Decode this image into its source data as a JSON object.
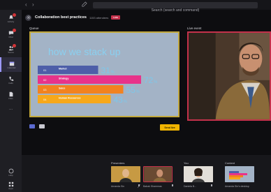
{
  "top_bar": {
    "search_placeholder": "Search (search and command)"
  },
  "sidebar": {
    "items": [
      {
        "label": "Activity",
        "icon": "bell-icon"
      },
      {
        "label": "Chat",
        "icon": "chat-icon"
      },
      {
        "label": "Teams",
        "icon": "teams-icon"
      },
      {
        "label": "Calendar",
        "icon": "calendar-icon"
      },
      {
        "label": "Calls",
        "icon": "phone-icon"
      },
      {
        "label": "Files",
        "icon": "file-icon"
      },
      {
        "label": "···",
        "icon": "more-icon"
      }
    ],
    "bottom_items": [
      {
        "label": "Help",
        "icon": "help-icon"
      },
      {
        "label": "Apps",
        "icon": "apps-icon"
      }
    ]
  },
  "event": {
    "title": "Collaboration best practices",
    "attendees": "1153 attendees",
    "live_badge": "LIVE"
  },
  "queue": {
    "label": "Queue",
    "slide_title": "how we stack up",
    "rows": [
      {
        "num": "01",
        "name": "Market",
        "value": 31,
        "color": "#4d5ea8"
      },
      {
        "num": "02",
        "name": "Strategy",
        "value": 72,
        "color": "#e8338a"
      },
      {
        "num": "03",
        "name": "Sales",
        "value": 55,
        "color": "#f2821f"
      },
      {
        "num": "04",
        "name": "Human Resources",
        "value": 43,
        "color": "#f7a81b"
      }
    ],
    "send_live_label": "Send live"
  },
  "live": {
    "label": "Live event"
  },
  "presenters": {
    "label": "Presenters",
    "people": [
      {
        "name": "Amanda Sin"
      },
      {
        "name": "Babak Shammas"
      }
    ]
  },
  "you": {
    "label": "You",
    "name": "Daniela B..."
  },
  "content": {
    "label": "Content",
    "name": "Amanda Sin's desktop"
  },
  "colors": {
    "accent": "#9c98ff",
    "live": "#c4314b",
    "queue_border": "#c2a83b",
    "send_button": "#f1b400"
  }
}
